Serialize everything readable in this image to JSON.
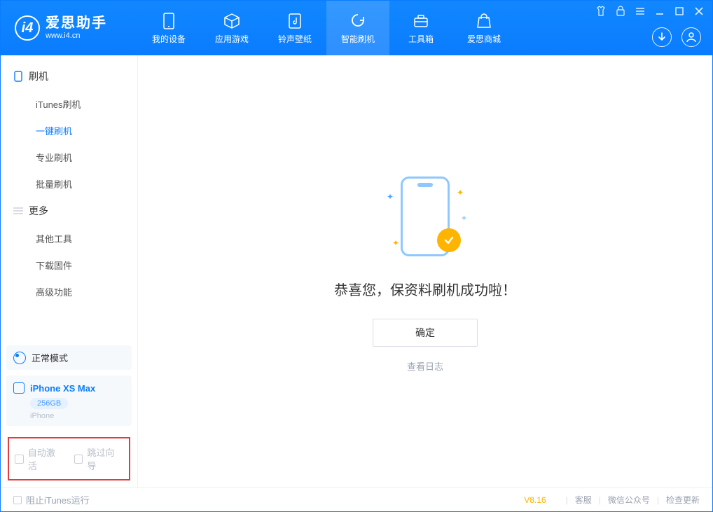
{
  "app": {
    "name_cn": "爱思助手",
    "name_en": "www.i4.cn"
  },
  "nav": {
    "items": [
      {
        "label": "我的设备"
      },
      {
        "label": "应用游戏"
      },
      {
        "label": "铃声壁纸"
      },
      {
        "label": "智能刷机"
      },
      {
        "label": "工具箱"
      },
      {
        "label": "爱思商城"
      }
    ],
    "active_index": 3
  },
  "sidebar": {
    "section_flash": {
      "title": "刷机"
    },
    "flash_items": [
      {
        "label": "iTunes刷机"
      },
      {
        "label": "一键刷机"
      },
      {
        "label": "专业刷机"
      },
      {
        "label": "批量刷机"
      }
    ],
    "flash_active_index": 1,
    "section_more": {
      "title": "更多"
    },
    "more_items": [
      {
        "label": "其他工具"
      },
      {
        "label": "下载固件"
      },
      {
        "label": "高级功能"
      }
    ],
    "mode": {
      "label": "正常模式"
    },
    "device": {
      "name": "iPhone XS Max",
      "storage": "256GB",
      "type": "iPhone"
    },
    "options": {
      "auto_activate": "自动激活",
      "skip_guide": "跳过向导"
    }
  },
  "result": {
    "title": "恭喜您，保资料刷机成功啦！",
    "ok": "确定",
    "view_log": "查看日志"
  },
  "footer": {
    "block_itunes": "阻止iTunes运行",
    "version": "V8.16",
    "links": [
      "客服",
      "微信公众号",
      "检查更新"
    ]
  }
}
